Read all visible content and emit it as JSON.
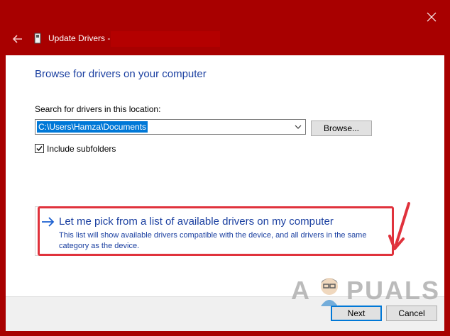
{
  "window": {
    "title": "Update Drivers -",
    "accent_color": "#a80000"
  },
  "content": {
    "heading": "Browse for drivers on your computer",
    "search_label": "Search for drivers in this location:",
    "path_value": "C:\\Users\\Hamza\\Documents",
    "browse_label": "Browse...",
    "include_subfolders_label": "Include subfolders",
    "include_subfolders_checked": true,
    "option": {
      "title": "Let me pick from a list of available drivers on my computer",
      "description": "This list will show available drivers compatible with the device, and all drivers in the same category as the device."
    }
  },
  "footer": {
    "next_label": "Next",
    "cancel_label": "Cancel"
  },
  "watermark": {
    "prefix": "A",
    "suffix": "PUALS"
  },
  "icons": {
    "back": "back-arrow-icon",
    "close": "close-icon",
    "device": "device-icon",
    "dropdown": "chevron-down-icon",
    "option_arrow": "arrow-right-icon",
    "annotation": "red-arrow-annotation"
  }
}
